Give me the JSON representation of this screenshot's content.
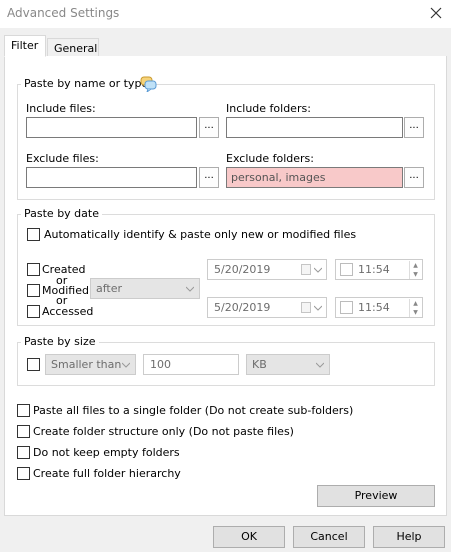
{
  "window": {
    "title": "Advanced Settings"
  },
  "tabs": [
    {
      "label": "Filter"
    },
    {
      "label": "General"
    }
  ],
  "name_group": {
    "legend": "Paste by name or type",
    "include_files_label": "Include files:",
    "include_files_value": "",
    "include_folders_label": "Include folders:",
    "include_folders_value": "",
    "exclude_files_label": "Exclude files:",
    "exclude_files_value": "",
    "exclude_folders_label": "Exclude folders:",
    "exclude_folders_value": "personal, images",
    "browse_label": "..."
  },
  "date_group": {
    "legend": "Paste by date",
    "auto_identify_label": "Automatically identify & paste only new or modified files",
    "created_label": "Created",
    "or1": "or",
    "modified_label": "Modified",
    "or2": "or",
    "accessed_label": "Accessed",
    "relation_value": "after",
    "date1": "5/20/2019",
    "time1": "11:54",
    "date2": "5/20/2019",
    "time2": "11:54"
  },
  "size_group": {
    "legend": "Paste by size",
    "comparison_value": "Smaller than",
    "size_value": "100",
    "unit_value": "KB"
  },
  "options": {
    "single_folder_label": "Paste all files to a single folder (Do not create sub-folders)",
    "structure_only_label": "Create folder structure only (Do not paste files)",
    "no_empty_label": "Do not keep empty folders",
    "full_hierarchy_label": "Create full folder hierarchy"
  },
  "buttons": {
    "preview": "Preview",
    "ok": "OK",
    "cancel": "Cancel",
    "help": "Help"
  },
  "colors": {
    "exclude_highlight": "#f8c9c9"
  }
}
